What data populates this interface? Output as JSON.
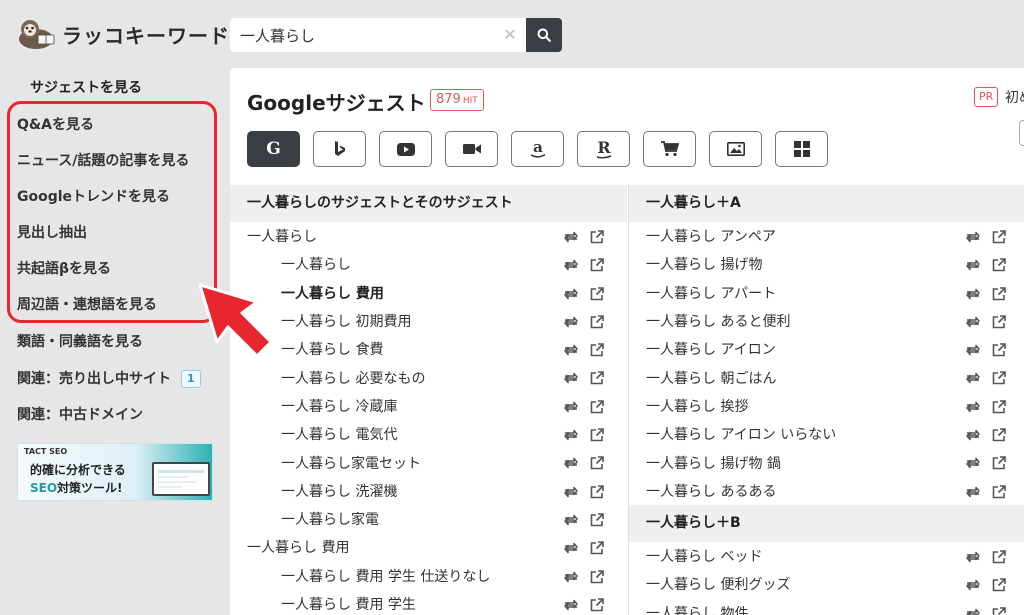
{
  "header": {
    "brand": "ラッコキーワード",
    "search_value": "一人暮らし",
    "clear_symbol": "✕"
  },
  "sidebar": {
    "title": "サジェストを見る",
    "items": [
      {
        "label": "Q&Aを見る"
      },
      {
        "label": "ニュース/話題の記事を見る"
      },
      {
        "label": "Googleトレンドを見る"
      },
      {
        "label": "見出し抽出"
      },
      {
        "label": "共起語βを見る"
      },
      {
        "label": "周辺語・連想語を見る"
      },
      {
        "label": "類語・同義語を見る"
      },
      {
        "label": "関連：売り出し中サイト",
        "badge": "1"
      },
      {
        "label": "関連：中古ドメイン"
      }
    ],
    "highlight_color": "#e8262e",
    "banner": {
      "brand": "TACT SEO",
      "line1": "的確に分析できる",
      "line2_accent": "SEO",
      "line2_rest": "対策ツール!"
    }
  },
  "main": {
    "title": "Googleサジェスト",
    "hit_count": "879",
    "hit_unit": "HIT",
    "pr_label": "PR",
    "pr_text": "初め",
    "engines": [
      {
        "name": "google",
        "glyph": "G",
        "active": true
      },
      {
        "name": "bing",
        "glyph": "",
        "active": false
      },
      {
        "name": "youtube",
        "glyph": "",
        "active": false
      },
      {
        "name": "video",
        "glyph": "",
        "active": false
      },
      {
        "name": "amazon",
        "glyph": "a",
        "active": false
      },
      {
        "name": "rakuten",
        "glyph": "R",
        "active": false
      },
      {
        "name": "shopping",
        "glyph": "",
        "active": false
      },
      {
        "name": "image",
        "glyph": "",
        "active": false
      },
      {
        "name": "apps",
        "glyph": "",
        "active": false
      }
    ],
    "left_column": {
      "heading": "一人暮らしのサジェストとそのサジェスト",
      "rows": [
        {
          "text": "一人暮らし",
          "level": 1
        },
        {
          "text": "一人暮らし",
          "level": 2
        },
        {
          "text": "一人暮らし 費用",
          "level": 2,
          "strong": true
        },
        {
          "text": "一人暮らし 初期費用",
          "level": 2
        },
        {
          "text": "一人暮らし 食費",
          "level": 2
        },
        {
          "text": "一人暮らし 必要なもの",
          "level": 2
        },
        {
          "text": "一人暮らし 冷蔵庫",
          "level": 2
        },
        {
          "text": "一人暮らし 電気代",
          "level": 2
        },
        {
          "text": "一人暮らし家電セット",
          "level": 2
        },
        {
          "text": "一人暮らし 洗濯機",
          "level": 2
        },
        {
          "text": "一人暮らし家電",
          "level": 2
        },
        {
          "text": "一人暮らし 費用",
          "level": 1
        },
        {
          "text": "一人暮らし 費用 学生 仕送りなし",
          "level": 2
        },
        {
          "text": "一人暮らし 費用 学生",
          "level": 2
        }
      ]
    },
    "right_groups": [
      {
        "heading": "一人暮らし＋A",
        "rows": [
          "一人暮らし アンペア",
          "一人暮らし 揚げ物",
          "一人暮らし アパート",
          "一人暮らし あると便利",
          "一人暮らし アイロン",
          "一人暮らし 朝ごはん",
          "一人暮らし 挨拶",
          "一人暮らし アイロン いらない",
          "一人暮らし 揚げ物 鍋",
          "一人暮らし あるある"
        ]
      },
      {
        "heading": "一人暮らし＋B",
        "rows": [
          "一人暮らし ベッド",
          "一人暮らし 便利グッズ",
          "一人暮らし 物件"
        ]
      }
    ]
  },
  "colors": {
    "accent_dark": "#3a3f45",
    "hit_red": "#e0575a",
    "panel_bg": "#ffffff",
    "page_bg": "#e6e6e6"
  }
}
